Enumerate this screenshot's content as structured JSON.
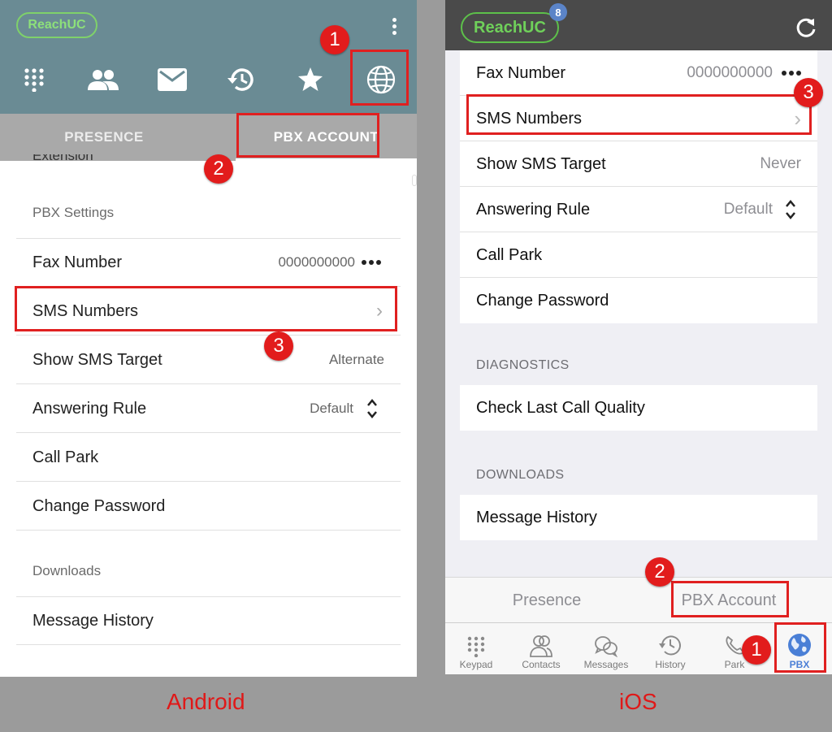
{
  "android": {
    "logo": "ReachUC",
    "tabs": {
      "presence": "PRESENCE",
      "pbx": "PBX ACCOUNT"
    },
    "cut_row": "Extension",
    "sections": {
      "pbx_settings": "PBX Settings",
      "downloads": "Downloads"
    },
    "rows": {
      "fax": {
        "label": "Fax Number",
        "value": "0000000000"
      },
      "sms": {
        "label": "SMS Numbers",
        "value": "›"
      },
      "show_sms": {
        "label": "Show SMS Target",
        "value": "Alternate"
      },
      "answering": {
        "label": "Answering Rule",
        "value": "Default"
      },
      "call_park": {
        "label": "Call Park"
      },
      "change_password": {
        "label": "Change Password"
      },
      "message_history": {
        "label": "Message History"
      }
    },
    "os_label": "Android"
  },
  "ios": {
    "logo": "ReachUC",
    "badge": "8",
    "rows": {
      "fax": {
        "label": "Fax Number",
        "value": "0000000000"
      },
      "sms": {
        "label": "SMS Numbers",
        "value": "›"
      },
      "show_sms": {
        "label": "Show SMS Target",
        "value": "Never"
      },
      "answering": {
        "label": "Answering Rule",
        "value": "Default"
      },
      "call_park": {
        "label": "Call Park"
      },
      "change_password": {
        "label": "Change Password"
      },
      "check_quality": {
        "label": "Check Last Call Quality"
      },
      "message_history": {
        "label": "Message History"
      }
    },
    "sections": {
      "diagnostics": "DIAGNOSTICS",
      "downloads": "DOWNLOADS"
    },
    "tabs": {
      "presence": "Presence",
      "pbx": "PBX Account"
    },
    "tabbar": {
      "keypad": "Keypad",
      "contacts": "Contacts",
      "messages": "Messages",
      "history": "History",
      "park": "Park",
      "pbx": "PBX"
    },
    "os_label": "iOS"
  },
  "callouts": {
    "one": "1",
    "two": "2",
    "three": "3"
  },
  "colors": {
    "highlight": "#e02020",
    "android_header": "#6a8b94",
    "ios_header": "#4a4a4a",
    "brand_green": "#7fd16a",
    "ios_active": "#4a7fd6"
  }
}
